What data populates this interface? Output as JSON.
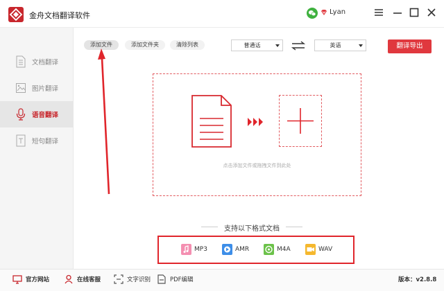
{
  "app": {
    "title": "金舟文档翻译软件",
    "user": "Lyan"
  },
  "colors": {
    "accent": "#c8272d",
    "export_button": "#e0383e",
    "dashed": "#e25a5f"
  },
  "sidebar": {
    "items": [
      {
        "label": "文档翻译",
        "icon": "document-icon",
        "active": false
      },
      {
        "label": "图片翻译",
        "icon": "image-icon",
        "active": false
      },
      {
        "label": "语音翻译",
        "icon": "microphone-icon",
        "active": true
      },
      {
        "label": "短句翻译",
        "icon": "text-icon",
        "active": false
      }
    ]
  },
  "toolbar": {
    "add_file": "添加文件",
    "add_folder": "添加文件夹",
    "clear_list": "清除列表",
    "source_lang": "普通话",
    "target_lang": "英语",
    "export": "翻译导出"
  },
  "drop_zone": {
    "hint": "点击添加文件或拖拽文件到此处"
  },
  "formats": {
    "title": "支持以下格式文档",
    "items": [
      {
        "label": "MP3",
        "color": "#f48fb1"
      },
      {
        "label": "AMR",
        "color": "#3d8ee8"
      },
      {
        "label": "M4A",
        "color": "#6cc24a"
      },
      {
        "label": "WAV",
        "color": "#f5b82e"
      }
    ]
  },
  "statusbar": {
    "website": "官方网站",
    "support": "在线客服",
    "ocr": "文字识别",
    "pdf": "PDF编辑",
    "version": "版本：v2.8.8"
  }
}
